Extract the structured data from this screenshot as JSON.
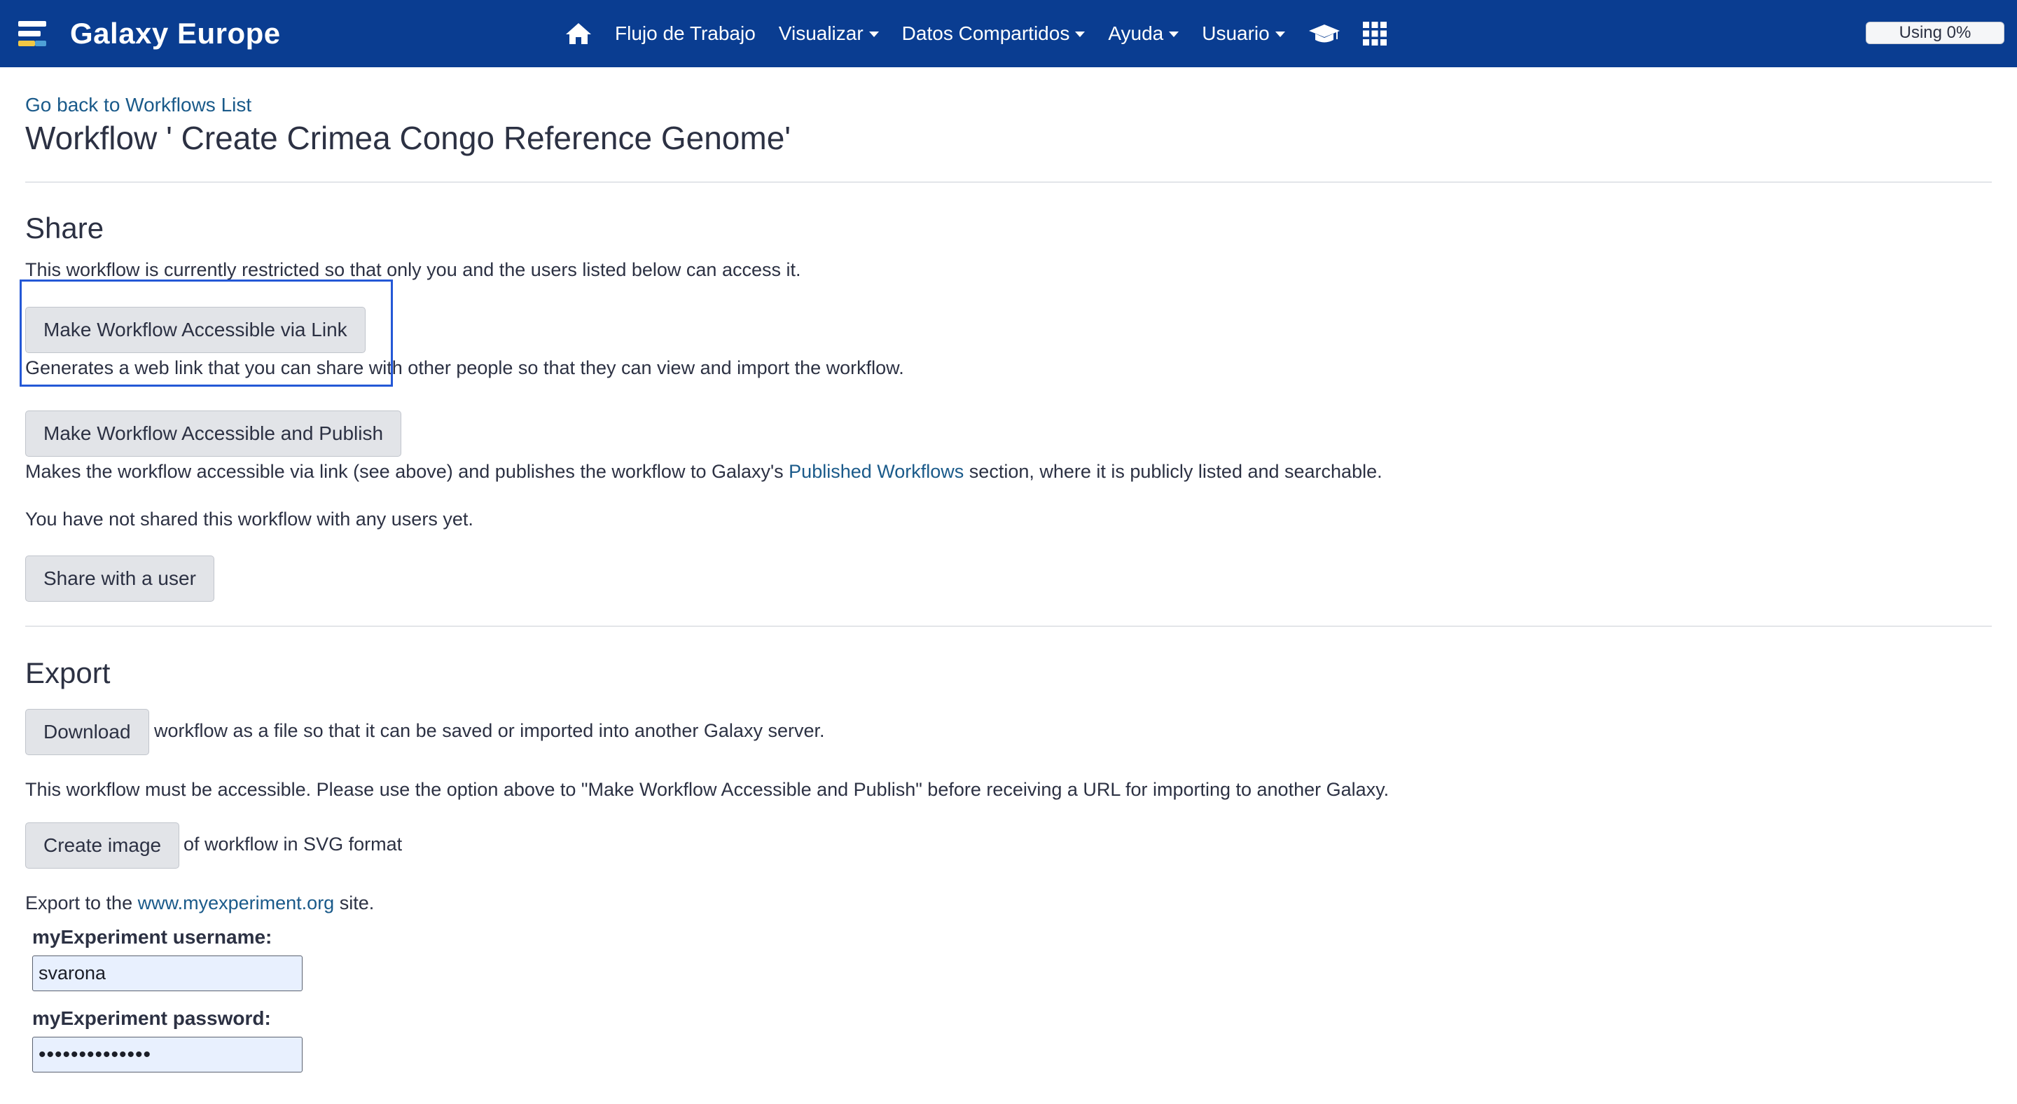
{
  "masthead": {
    "brand": "Galaxy Europe",
    "nav": [
      {
        "label": "Flujo de Trabajo",
        "dropdown": false
      },
      {
        "label": "Visualizar",
        "dropdown": true
      },
      {
        "label": "Datos Compartidos",
        "dropdown": true
      },
      {
        "label": "Ayuda",
        "dropdown": true
      },
      {
        "label": "Usuario",
        "dropdown": true
      }
    ],
    "icons": [
      "home-icon",
      "graduation-cap-icon",
      "apps-grid-icon"
    ],
    "quota": "Using 0%"
  },
  "page": {
    "back_link": "Go back to Workflows List",
    "title": "Workflow ' Create Crimea Congo Reference Genome'"
  },
  "share": {
    "heading": "Share",
    "status": "This workflow is currently restricted so that only you and the users listed below can access it.",
    "link_button": "Make Workflow Accessible via Link",
    "link_desc": "Generates a web link that you can share with other people so that they can view and import the workflow.",
    "publish_button": "Make Workflow Accessible and Publish",
    "publish_desc_before": "Makes the workflow accessible via link (see above) and publishes the workflow to Galaxy's",
    "publish_desc_link": "Published Workflows",
    "publish_desc_after": "section, where it is publicly listed and searchable.",
    "users_status": "You have not shared this workflow with any users yet.",
    "share_user_button": "Share with a user"
  },
  "export": {
    "heading": "Export",
    "download_button": "Download",
    "download_desc": "workflow as a file so that it can be saved or imported into another Galaxy server.",
    "url_note": "This workflow must be accessible. Please use the option above to \"Make Workflow Accessible and Publish\" before receiving a URL for importing to another Galaxy.",
    "image_button": "Create image",
    "image_desc": "of workflow in SVG format",
    "myexp_before": "Export to the",
    "myexp_link": "www.myexperiment.org",
    "myexp_after": "site.",
    "username_label": "myExperiment username:",
    "username_value": "svarona",
    "password_label": "myExperiment password:",
    "password_value": "••••••••••••••"
  },
  "colors": {
    "masthead": "#0a3d91",
    "link": "#1a5a8a",
    "highlight": "#2458d6"
  }
}
